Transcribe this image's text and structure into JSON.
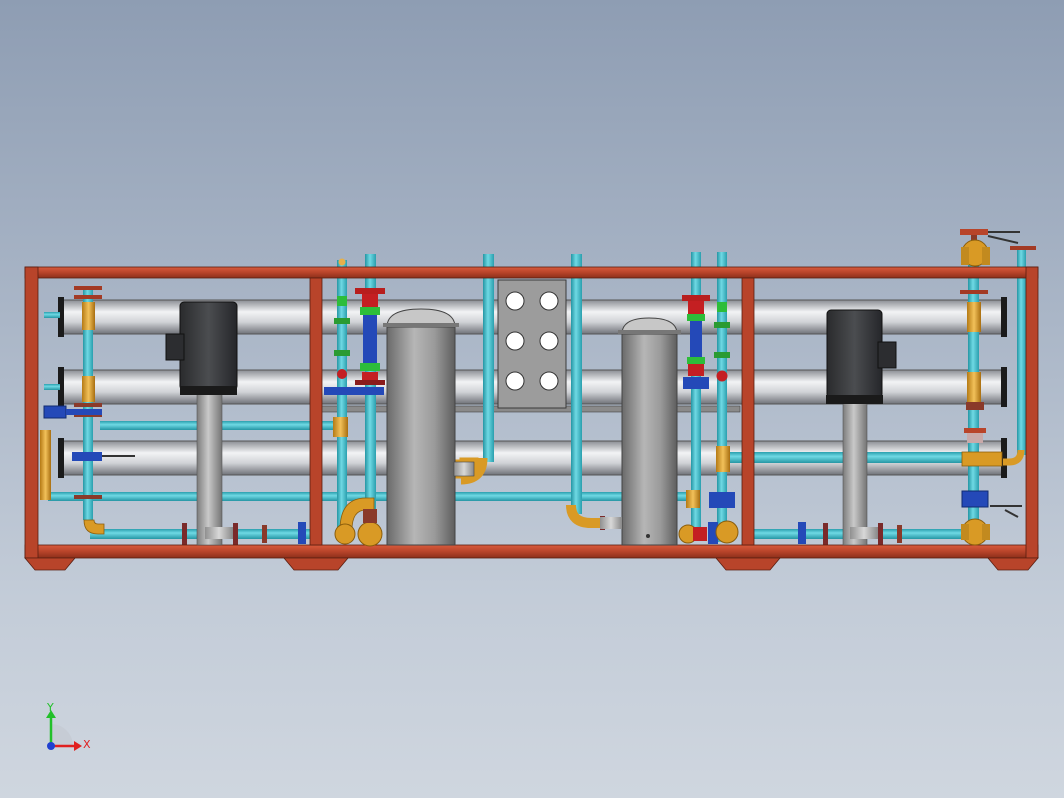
{
  "colors": {
    "background_top": "#8e9db3",
    "background_bottom": "#cfd6df",
    "frame": "#b8442a",
    "membrane_vessel": "#d2d4d8",
    "water_pipe": "#3ec1cf",
    "brass_fitting": "#e0a12c",
    "motor": "#3a3c3f",
    "pump_shaft": "#a7a7a7",
    "tank": "#a9a9a9",
    "valve_blue": "#2449b8",
    "valve_red": "#c41f22",
    "valve_green": "#2dbd3a",
    "axis_x": "#e02020",
    "axis_y": "#22c02a",
    "axis_z": "#2040d0"
  },
  "triad": {
    "x_label": "X",
    "y_label": "Y"
  },
  "components": {
    "frame": "skid-frame",
    "pressure_vessels": 4,
    "pumps": 2,
    "tanks": 2,
    "panel_ports": 6
  }
}
